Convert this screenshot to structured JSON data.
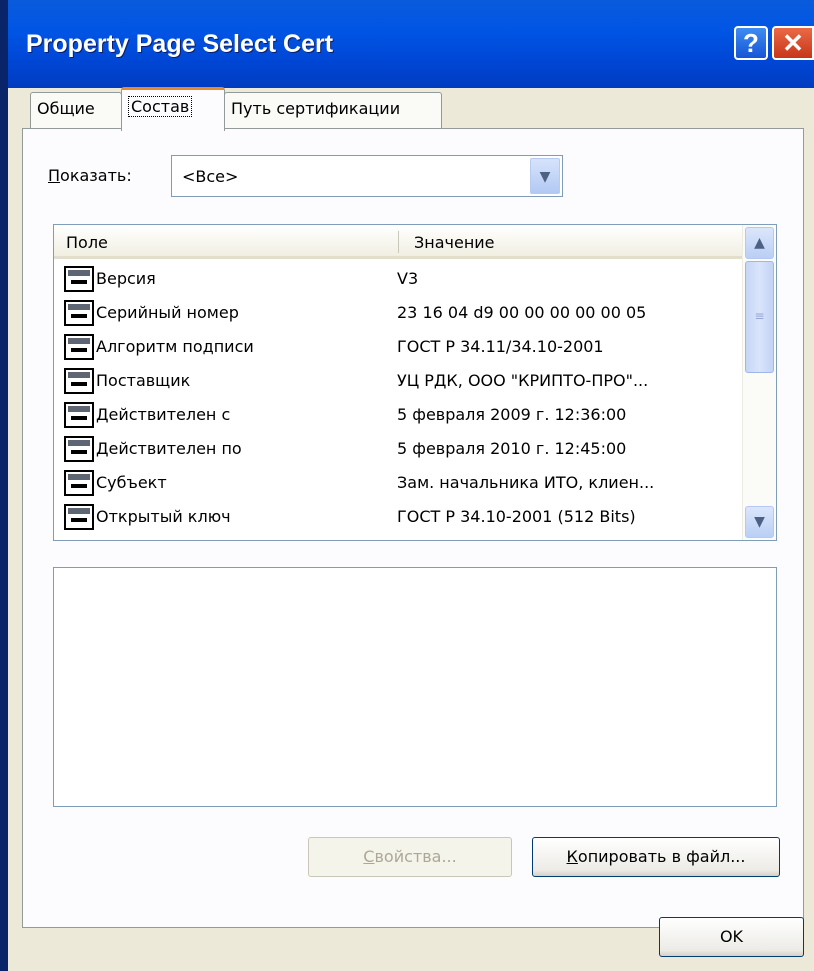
{
  "window": {
    "title": "Property Page Select Cert",
    "help_label": "?",
    "close_label": "✕"
  },
  "tabs": [
    {
      "label": "Общие",
      "active": false
    },
    {
      "label": "Состав",
      "active": true
    },
    {
      "label": "Путь сертификации",
      "active": false
    }
  ],
  "filter": {
    "label_accel": "П",
    "label_rest": "оказать:",
    "selected": "<Все>"
  },
  "list": {
    "col_field": "Поле",
    "col_value": "Значение",
    "rows": [
      {
        "field": "Версия",
        "value": "V3"
      },
      {
        "field": "Серийный номер",
        "value": "23 16 04 d9 00 00 00 00 00 05"
      },
      {
        "field": "Алгоритм подписи",
        "value": "ГОСТ Р 34.11/34.10-2001"
      },
      {
        "field": "Поставщик",
        "value": "УЦ РДК, ООО \"КРИПТО-ПРО\"..."
      },
      {
        "field": "Действителен с",
        "value": "5 февраля 2009 г. 12:36:00"
      },
      {
        "field": "Действителен по",
        "value": "5 февраля 2010 г. 12:45:00"
      },
      {
        "field": "Субъект",
        "value": "Зам. начальника ИТО, клиен..."
      },
      {
        "field": "Открытый ключ",
        "value": "ГОСТ Р 34.10-2001 (512 Bits)"
      }
    ]
  },
  "buttons": {
    "properties_accel": "С",
    "properties_rest": "войства...",
    "copy_accel": "К",
    "copy_rest": "опировать в файл...",
    "ok": "OK"
  },
  "colors": {
    "title_bar": "#0055e5",
    "active_tab_accent": "#e68b2c",
    "dialog_bg": "#ece9d8"
  },
  "icons": {
    "row_icon": "certificate-field-icon",
    "scroll_up": "chevron-up-icon",
    "scroll_down": "chevron-down-icon"
  }
}
